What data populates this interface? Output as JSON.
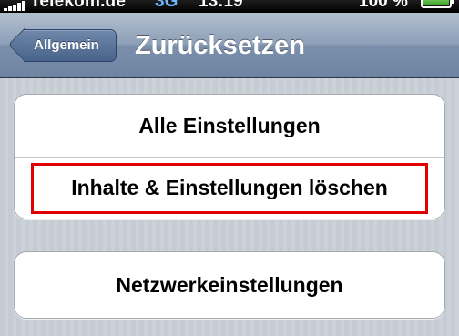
{
  "status_bar": {
    "carrier": "Telekom.de",
    "network": "3G",
    "time": "13:19",
    "battery_percent": "100 %",
    "battery_level": 1.0,
    "signal_bars": 5
  },
  "nav": {
    "back_label": "Allgemein",
    "title": "Zurücksetzen"
  },
  "groups": [
    {
      "items": [
        {
          "label": "Alle Einstellungen"
        },
        {
          "label": "Inhalte & Einstellungen löschen",
          "highlighted": true
        }
      ]
    },
    {
      "items": [
        {
          "label": "Netzwerkeinstellungen"
        }
      ]
    }
  ],
  "colors": {
    "nav_bar": "#8d9fb8",
    "back_button": "#5a7399",
    "highlight": "#e00000",
    "network_label": "#6fb6ff",
    "battery_fill": "#3b9c25"
  }
}
